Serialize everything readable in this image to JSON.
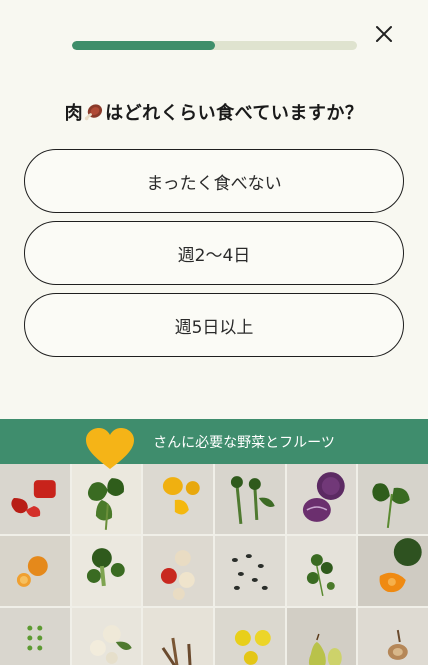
{
  "progress": {
    "fraction": 0.5
  },
  "header": {
    "close_icon": "close-icon"
  },
  "question": {
    "text_before": "肉",
    "icon": "meat-icon",
    "text_after": "はどれくらい食べていますか？"
  },
  "options": [
    {
      "label": "まったく食べない"
    },
    {
      "label": "週2〜4日"
    },
    {
      "label": "週5日以上"
    }
  ],
  "banner": {
    "text": "さんに必要な野菜とフルーツ",
    "heart_icon": "heart-icon",
    "colors": {
      "background": "#3f8d6d",
      "heart": "#f5b417"
    }
  },
  "gallery": {
    "tiles": [
      "red-bell-pepper",
      "kale",
      "yellow-bell-pepper",
      "broccolini",
      "red-cabbage",
      "kale",
      "orange",
      "broccoli",
      "apple",
      "beans",
      "parsley",
      "kabocha",
      "green-peas",
      "cauliflower",
      "burdock",
      "lemon",
      "pear",
      "potato"
    ]
  },
  "colors": {
    "accent": "#3e8e6a",
    "page_bg": "#f8f8f1"
  }
}
